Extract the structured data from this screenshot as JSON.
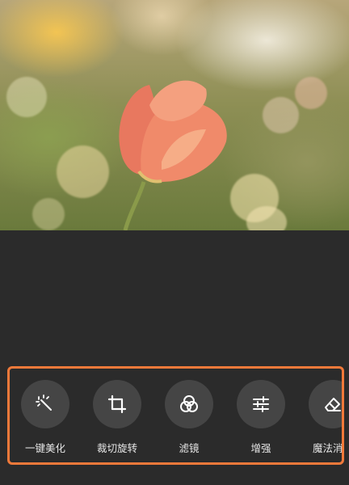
{
  "photo": {
    "subject_icon": "tulip-photo"
  },
  "toolbar": {
    "highlight_color": "#f0793a",
    "tools": [
      {
        "label": "一键美化",
        "icon": "magic-wand-icon"
      },
      {
        "label": "裁切旋转",
        "icon": "crop-icon"
      },
      {
        "label": "滤镜",
        "icon": "filter-circles-icon"
      },
      {
        "label": "增强",
        "icon": "sliders-icon"
      },
      {
        "label": "魔法消除",
        "icon": "eraser-icon"
      }
    ]
  }
}
